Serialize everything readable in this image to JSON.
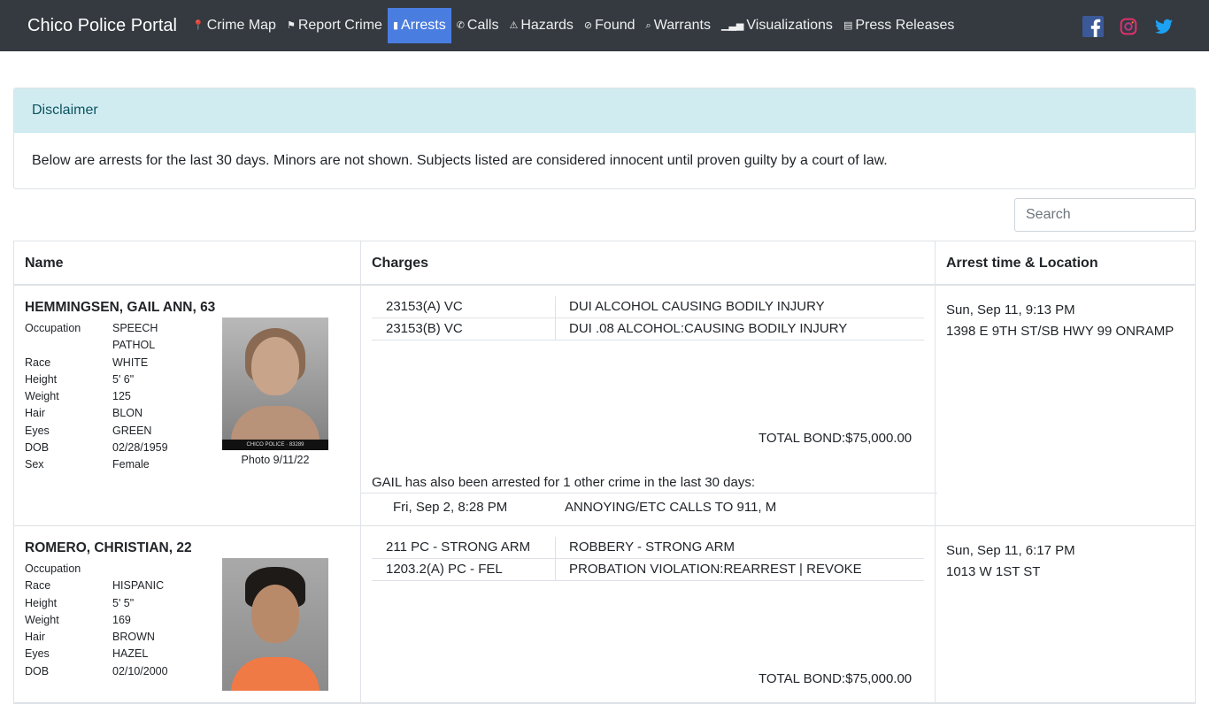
{
  "navbar": {
    "brand": "Chico Police Portal",
    "items": [
      {
        "icon": "map-marker-icon",
        "glyph": "📍",
        "label": "Crime Map"
      },
      {
        "icon": "flag-icon",
        "glyph": "⚑",
        "label": "Report Crime"
      },
      {
        "icon": "id-badge-icon",
        "glyph": "▮",
        "label": "Arrests",
        "active": true
      },
      {
        "icon": "phone-icon",
        "glyph": "✆",
        "label": "Calls"
      },
      {
        "icon": "warning-icon",
        "glyph": "⚠",
        "label": "Hazards"
      },
      {
        "icon": "compass-icon",
        "glyph": "⊘",
        "label": "Found"
      },
      {
        "icon": "search-icon",
        "glyph": "⌕",
        "label": "Warrants"
      },
      {
        "icon": "chart-icon",
        "glyph": "▁▃▅",
        "label": "Visualizations"
      },
      {
        "icon": "newspaper-icon",
        "glyph": "▤",
        "label": "Press Releases"
      }
    ],
    "social": [
      "facebook-icon",
      "instagram-icon",
      "twitter-icon"
    ],
    "colors": {
      "bg": "#343a40",
      "active": "#4a7de0"
    }
  },
  "disclaimer": {
    "title": "Disclaimer",
    "text": "Below are arrests for the last 30 days. Minors are not shown. Subjects listed are considered innocent until proven guilty by a court of law."
  },
  "search": {
    "placeholder": "Search"
  },
  "table": {
    "headers": {
      "name": "Name",
      "charges": "Charges",
      "arrest": "Arrest time & Location"
    },
    "rows": [
      {
        "name": "HEMMINGSEN, GAIL ANN, 63",
        "attributes": {
          "occupation": {
            "label": "Occupation",
            "value": "SPEECH PATHOL"
          },
          "race": {
            "label": "Race",
            "value": "WHITE"
          },
          "height": {
            "label": "Height",
            "value": "5' 6\""
          },
          "weight": {
            "label": "Weight",
            "value": "125"
          },
          "hair": {
            "label": "Hair",
            "value": "BLON"
          },
          "eyes": {
            "label": "Eyes",
            "value": "GREEN"
          },
          "dob": {
            "label": "DOB",
            "value": "02/28/1959"
          },
          "sex": {
            "label": "Sex",
            "value": "Female"
          }
        },
        "photo_strip": "CHICO POLICE · 83289",
        "photo_caption": "Photo 9/11/22",
        "charges": [
          {
            "code": "23153(A) VC",
            "desc": "DUI ALCOHOL CAUSING BODILY INJURY"
          },
          {
            "code": "23153(B) VC",
            "desc": "DUI .08 ALCOHOL:CAUSING BODILY INJURY"
          }
        ],
        "bond": "TOTAL BOND:$75,000.00",
        "also_text": "GAIL has also been arrested for 1 other crime in the last 30 days:",
        "other": {
          "date": "Fri, Sep 2, 8:28 PM",
          "desc": "ANNOYING/ETC CALLS TO 911, M"
        },
        "arrest_time": "Sun, Sep 11, 9:13 PM",
        "arrest_location": "1398 E 9TH ST/SB HWY 99 ONRAMP"
      },
      {
        "name": "ROMERO, CHRISTIAN, 22",
        "attributes": {
          "occupation": {
            "label": "Occupation",
            "value": ""
          },
          "race": {
            "label": "Race",
            "value": "HISPANIC"
          },
          "height": {
            "label": "Height",
            "value": "5' 5\""
          },
          "weight": {
            "label": "Weight",
            "value": "169"
          },
          "hair": {
            "label": "Hair",
            "value": "BROWN"
          },
          "eyes": {
            "label": "Eyes",
            "value": "HAZEL"
          },
          "dob": {
            "label": "DOB",
            "value": "02/10/2000"
          }
        },
        "charges": [
          {
            "code": "211 PC - STRONG ARM",
            "desc": "ROBBERY - STRONG ARM"
          },
          {
            "code": "1203.2(A) PC - FEL",
            "desc": "PROBATION VIOLATION:REARREST | REVOKE"
          }
        ],
        "bond": "TOTAL BOND:$75,000.00",
        "arrest_time": "Sun, Sep 11, 6:17 PM",
        "arrest_location": "1013 W 1ST ST"
      }
    ]
  }
}
